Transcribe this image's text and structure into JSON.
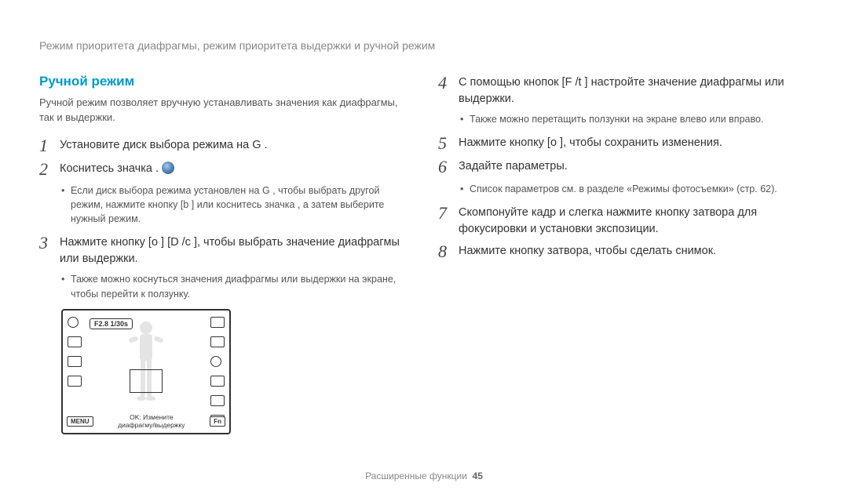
{
  "header": "Режим приоритета диафрагмы, режим приоритета выдержки и ручной режим",
  "section_title": "Ручной режим",
  "intro": "Ручной режим позволяет вручную устанавливать значения как диафрагмы, так и выдержки.",
  "left_steps": [
    {
      "num": "1",
      "body": "Установите диск выбора режима на G        .",
      "bullets": []
    },
    {
      "num": "2",
      "body": "Коснитесь значка       .",
      "bullets": [
        "Если диск выбора режима установлен на G       , чтобы выбрать другой режим, нажмите кнопку [b    ] или коснитесь значка     , а затем выберите нужный режим."
      ]
    },
    {
      "num": "3",
      "body": "Нажмите кнопку [o     ]   [D      /c    ], чтобы выбрать значение диафрагмы или выдержки.",
      "bullets": [
        "Также можно коснуться значения диафрагмы или выдержки на экране, чтобы перейти к ползунку."
      ]
    }
  ],
  "right_steps": [
    {
      "num": "4",
      "body": "С помощью кнопок [F  /t   ] настройте значение диафрагмы или выдержки.",
      "bullets": [
        "Также можно перетащить ползунки на экране влево или вправо."
      ]
    },
    {
      "num": "5",
      "body": "Нажмите кнопку [o     ], чтобы сохранить изменения.",
      "bullets": []
    },
    {
      "num": "6",
      "body": "Задайте параметры.",
      "bullets": [
        "Список параметров см. в разделе «Режимы фотосъемки» (стр. 62)."
      ]
    },
    {
      "num": "7",
      "body": "Скомпонуйте кадр и слегка нажмите кнопку затвора для фокусировки и установки экспозиции.",
      "bullets": []
    },
    {
      "num": "8",
      "body": "Нажмите кнопку затвора, чтобы сделать снимок.",
      "bullets": []
    }
  ],
  "lcd": {
    "badge": "F2.8 1/30s",
    "menu": "MENU",
    "fn": "Fn",
    "bottom_line1": "OK: Измените",
    "bottom_line2": "диафрагму/выдержку"
  },
  "footer_label": "Расширенные функции",
  "footer_page": "45"
}
